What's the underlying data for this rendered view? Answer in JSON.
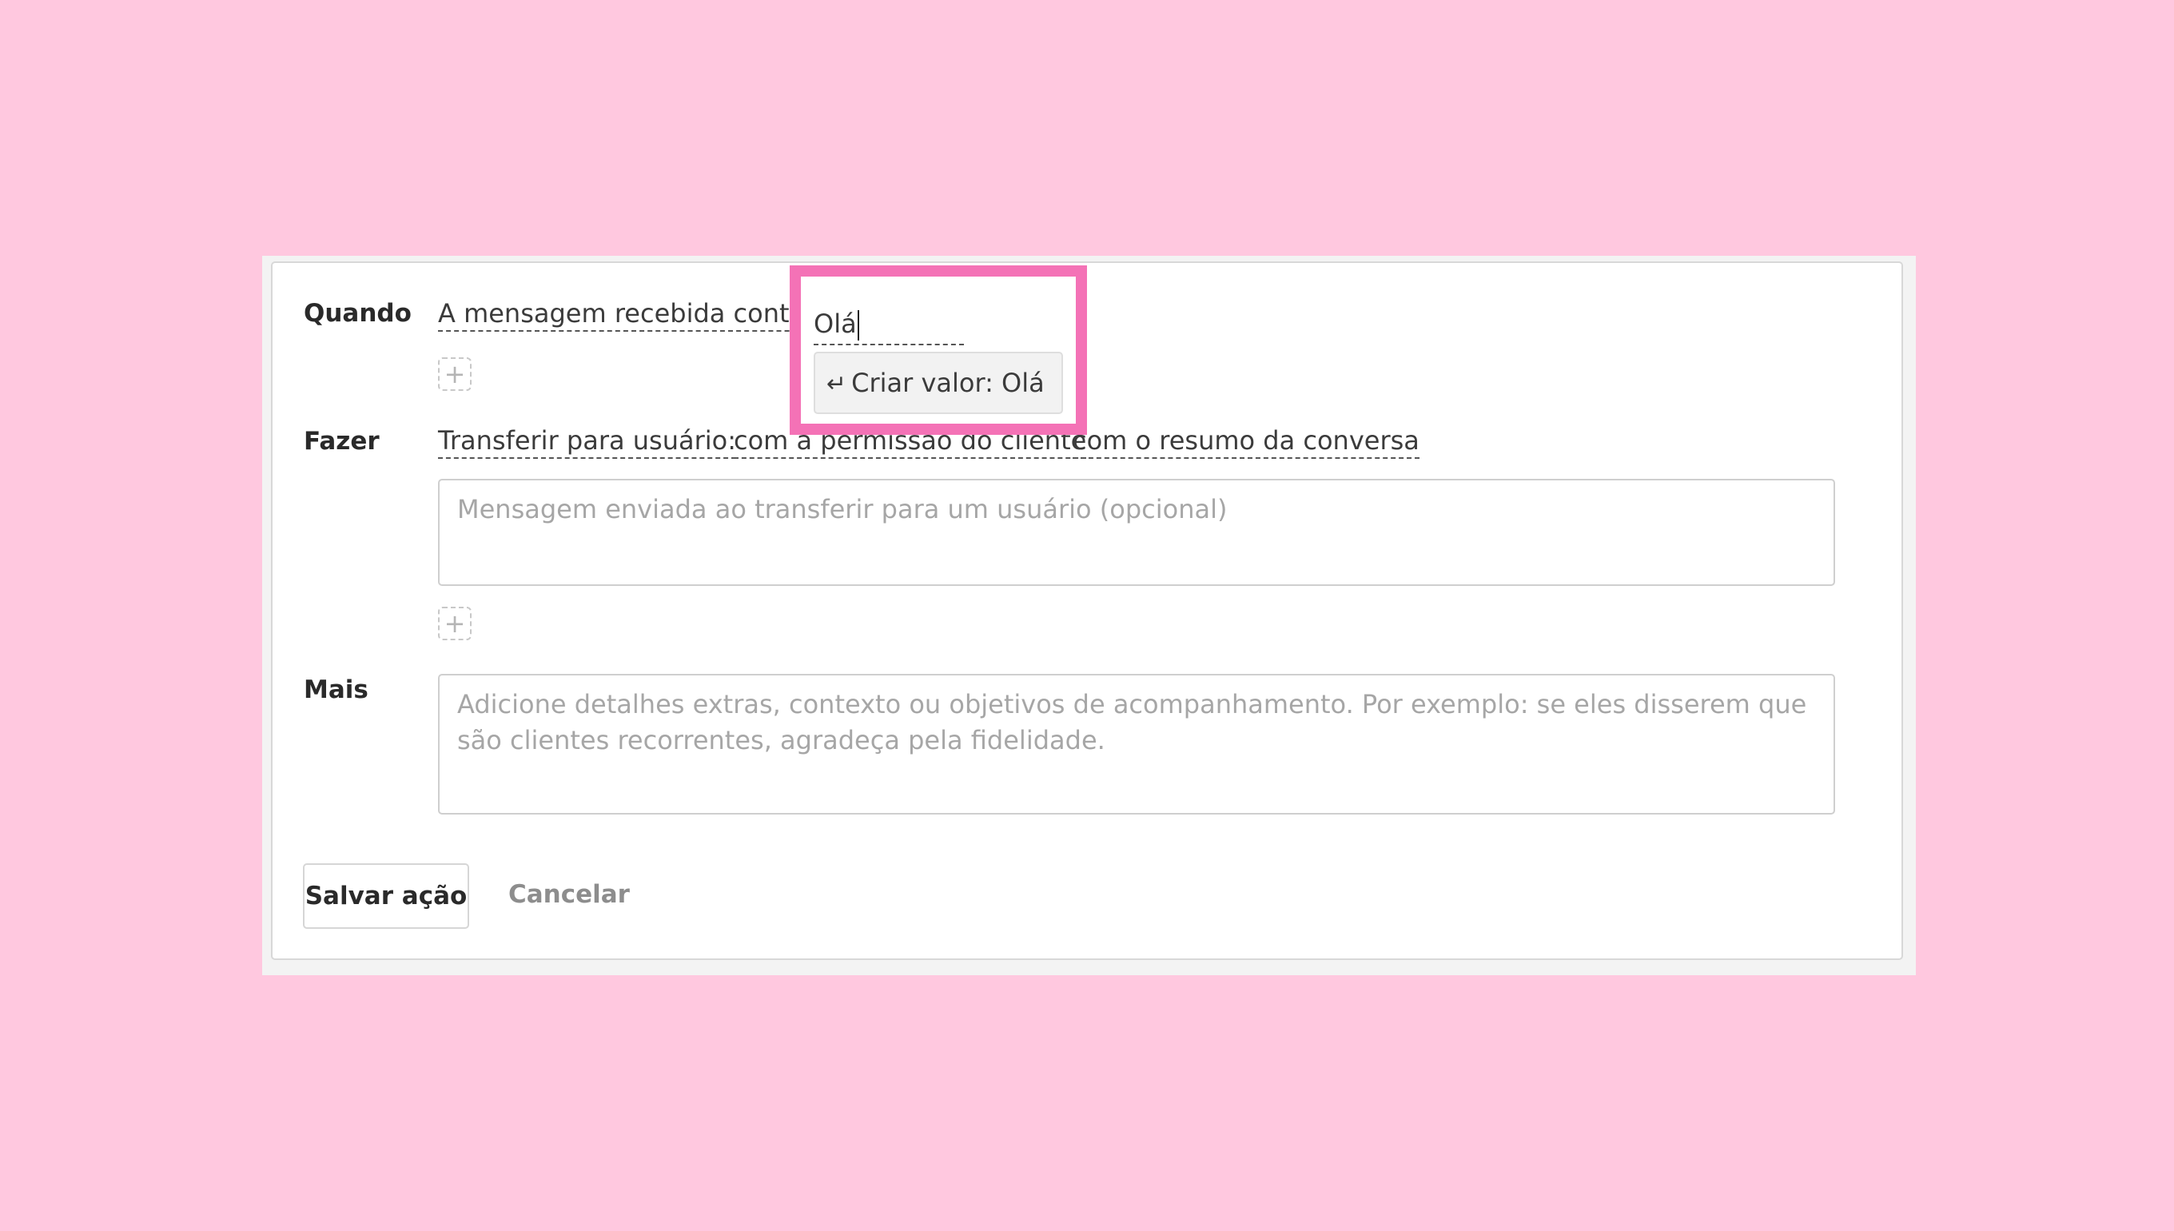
{
  "when": {
    "label": "Quando",
    "condition": "A mensagem recebida contém",
    "value": "Olá"
  },
  "suggestion": {
    "icon": "enter-arrow-icon",
    "text": "Criar valor: Olá"
  },
  "do": {
    "label": "Fazer",
    "action": "Transferir para usuário:",
    "option1": "com a permissão do cliente",
    "option2": "com o resumo da conversa",
    "message_placeholder": "Mensagem enviada ao transferir para um usuário (opcional)"
  },
  "more": {
    "label": "Mais",
    "placeholder": "Adicione detalhes extras, contexto ou objetivos de acompanhamento. Por exemplo: se eles disserem que são clientes recorrentes, agradeça pela fidelidade."
  },
  "buttons": {
    "save": "Salvar ação",
    "cancel": "Cancelar",
    "add": "+"
  },
  "colors": {
    "background": "#ffc8df",
    "highlight": "#f472b6"
  }
}
